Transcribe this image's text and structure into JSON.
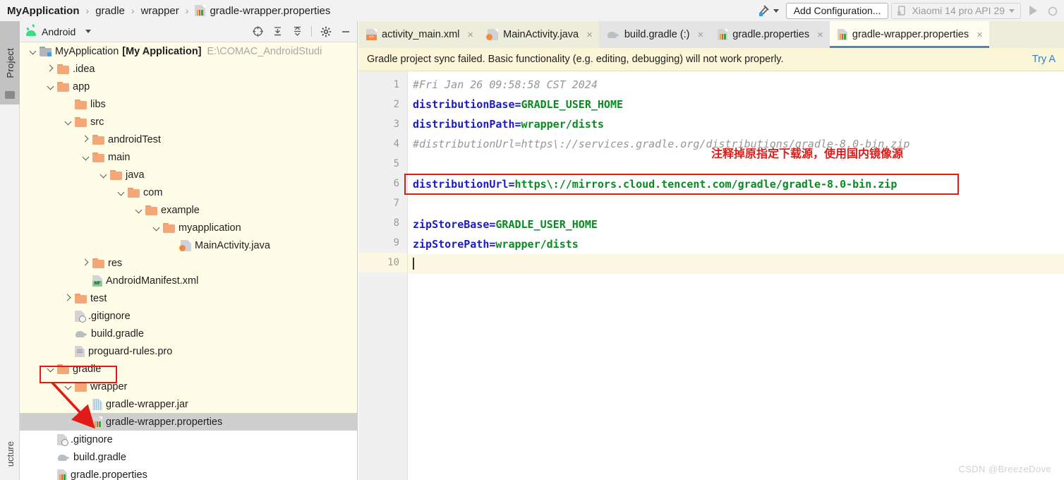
{
  "breadcrumb": {
    "items": [
      {
        "label": "MyApplication",
        "bold": true
      },
      {
        "label": "gradle",
        "bold": false
      },
      {
        "label": "wrapper",
        "bold": false
      },
      {
        "label": "gradle-wrapper.properties",
        "bold": false,
        "icon": "properties-file-icon"
      }
    ],
    "separator": "›"
  },
  "toolbar": {
    "hammer_icon": "build-hammer-icon",
    "add_configuration_label": "Add Configuration...",
    "device_label": "Xiaomi 14 pro API 29",
    "device_icon": "device-phone-icon",
    "run_icon": "run-triangle-icon",
    "dropdown_icon": "chevron-down-icon"
  },
  "left_strip": {
    "project_tab": "Project",
    "structure_tab": "ucture"
  },
  "panel": {
    "view_label": "Android",
    "view_icon": "android-robot-icon",
    "dropdown_icon": "chevron-down-icon",
    "tools": [
      "locate-target-icon",
      "expand-all-icon",
      "collapse-all-icon",
      "gear-icon",
      "minimize-icon"
    ]
  },
  "tree": [
    {
      "indent": 0,
      "arrow": "down",
      "icon": "module-icon",
      "label": "MyApplication",
      "bold_suffix": "[My Application]",
      "path": "E:\\COMAC_AndroidStudi",
      "bg": "yellow"
    },
    {
      "indent": 1,
      "arrow": "right",
      "icon": "folder-icon",
      "label": ".idea",
      "bg": "yellow"
    },
    {
      "indent": 1,
      "arrow": "down",
      "icon": "folder-icon",
      "label": "app",
      "bg": "yellow"
    },
    {
      "indent": 2,
      "arrow": "none",
      "icon": "folder-icon",
      "label": "libs",
      "bg": "yellow"
    },
    {
      "indent": 2,
      "arrow": "down",
      "icon": "folder-icon",
      "label": "src",
      "bg": "yellow"
    },
    {
      "indent": 3,
      "arrow": "right",
      "icon": "folder-icon",
      "label": "androidTest",
      "bg": "yellow"
    },
    {
      "indent": 3,
      "arrow": "down",
      "icon": "folder-icon",
      "label": "main",
      "bg": "yellow"
    },
    {
      "indent": 4,
      "arrow": "down",
      "icon": "folder-icon",
      "label": "java",
      "bg": "yellow"
    },
    {
      "indent": 5,
      "arrow": "down",
      "icon": "folder-icon",
      "label": "com",
      "bg": "yellow"
    },
    {
      "indent": 6,
      "arrow": "down",
      "icon": "folder-icon",
      "label": "example",
      "bg": "yellow"
    },
    {
      "indent": 7,
      "arrow": "down",
      "icon": "folder-icon",
      "label": "myapplication",
      "bg": "yellow"
    },
    {
      "indent": 8,
      "arrow": "none",
      "icon": "java-class-icon",
      "label": "MainActivity.java",
      "bg": "yellow"
    },
    {
      "indent": 3,
      "arrow": "right",
      "icon": "folder-icon",
      "label": "res",
      "bg": "yellow"
    },
    {
      "indent": 3,
      "arrow": "none",
      "icon": "manifest-file-icon",
      "label": "AndroidManifest.xml",
      "bg": "yellow"
    },
    {
      "indent": 2,
      "arrow": "right",
      "icon": "folder-icon",
      "label": "test",
      "bg": "yellow"
    },
    {
      "indent": 2,
      "arrow": "none",
      "icon": "gitignore-file-icon",
      "label": ".gitignore",
      "bg": "yellow"
    },
    {
      "indent": 2,
      "arrow": "none",
      "icon": "gradle-elephant-icon",
      "label": "build.gradle",
      "bg": "yellow"
    },
    {
      "indent": 2,
      "arrow": "none",
      "icon": "text-file-icon",
      "label": "proguard-rules.pro",
      "bg": "yellow"
    },
    {
      "indent": 1,
      "arrow": "down",
      "icon": "folder-icon",
      "label": "gradle",
      "bg": "yellow"
    },
    {
      "indent": 2,
      "arrow": "down",
      "icon": "folder-icon",
      "label": "wrapper",
      "bg": "yellow"
    },
    {
      "indent": 3,
      "arrow": "none",
      "icon": "jar-file-icon",
      "label": "gradle-wrapper.jar",
      "bg": "yellow"
    },
    {
      "indent": 3,
      "arrow": "none",
      "icon": "properties-file-icon",
      "label": "gradle-wrapper.properties",
      "bg": "selected"
    },
    {
      "indent": 1,
      "arrow": "none",
      "icon": "gitignore-file-icon",
      "label": ".gitignore",
      "bg": "white"
    },
    {
      "indent": 1,
      "arrow": "none",
      "icon": "gradle-elephant-icon",
      "label": "build.gradle",
      "bg": "white"
    },
    {
      "indent": 1,
      "arrow": "none",
      "icon": "properties-file-icon",
      "label": "gradle.properties",
      "bg": "white"
    }
  ],
  "editor_tabs": [
    {
      "label": "activity_main.xml",
      "icon": "xml-layout-icon",
      "state": "normal",
      "close": "×"
    },
    {
      "label": "MainActivity.java",
      "icon": "java-class-icon",
      "state": "normal",
      "close": "×"
    },
    {
      "label": "build.gradle (:)",
      "icon": "gradle-elephant-icon",
      "state": "grey",
      "close": "×"
    },
    {
      "label": "gradle.properties",
      "icon": "properties-file-icon",
      "state": "grey",
      "close": "×"
    },
    {
      "label": "gradle-wrapper.properties",
      "icon": "properties-file-icon",
      "state": "active",
      "close": "×"
    }
  ],
  "notification": {
    "message": "Gradle project sync failed. Basic functionality (e.g. editing, debugging) will not work properly.",
    "link": "Try A"
  },
  "code": {
    "line_numbers": [
      "1",
      "2",
      "3",
      "4",
      "5",
      "6",
      "7",
      "8",
      "9",
      "10"
    ],
    "lines": [
      {
        "n": 1,
        "type": "comment",
        "text": "#Fri Jan 26 09:58:58 CST 2024"
      },
      {
        "n": 2,
        "type": "kv",
        "key": "distributionBase",
        "value": "GRADLE_USER_HOME"
      },
      {
        "n": 3,
        "type": "kv",
        "key": "distributionPath",
        "value": "wrapper/dists"
      },
      {
        "n": 4,
        "type": "comment",
        "text": "#distributionUrl=https\\://services.gradle.org/distributions/gradle-8.0-bin.zip"
      },
      {
        "n": 5,
        "type": "blank",
        "text": ""
      },
      {
        "n": 6,
        "type": "kv",
        "key": "distributionUrl",
        "value": "https\\://mirrors.cloud.tencent.com/gradle/gradle-8.0-bin.zip",
        "boxed": true
      },
      {
        "n": 7,
        "type": "blank",
        "text": ""
      },
      {
        "n": 8,
        "type": "kv",
        "key": "zipStoreBase",
        "value": "GRADLE_USER_HOME"
      },
      {
        "n": 9,
        "type": "kv",
        "key": "zipStorePath",
        "value": "wrapper/dists"
      },
      {
        "n": 10,
        "type": "caret",
        "text": "",
        "current": true
      }
    ]
  },
  "annotations": {
    "note_text": "注释掉原指定下载源，使用国内镜像源",
    "color": "#e01b18"
  },
  "watermark": "CSDN @BreezeDove"
}
